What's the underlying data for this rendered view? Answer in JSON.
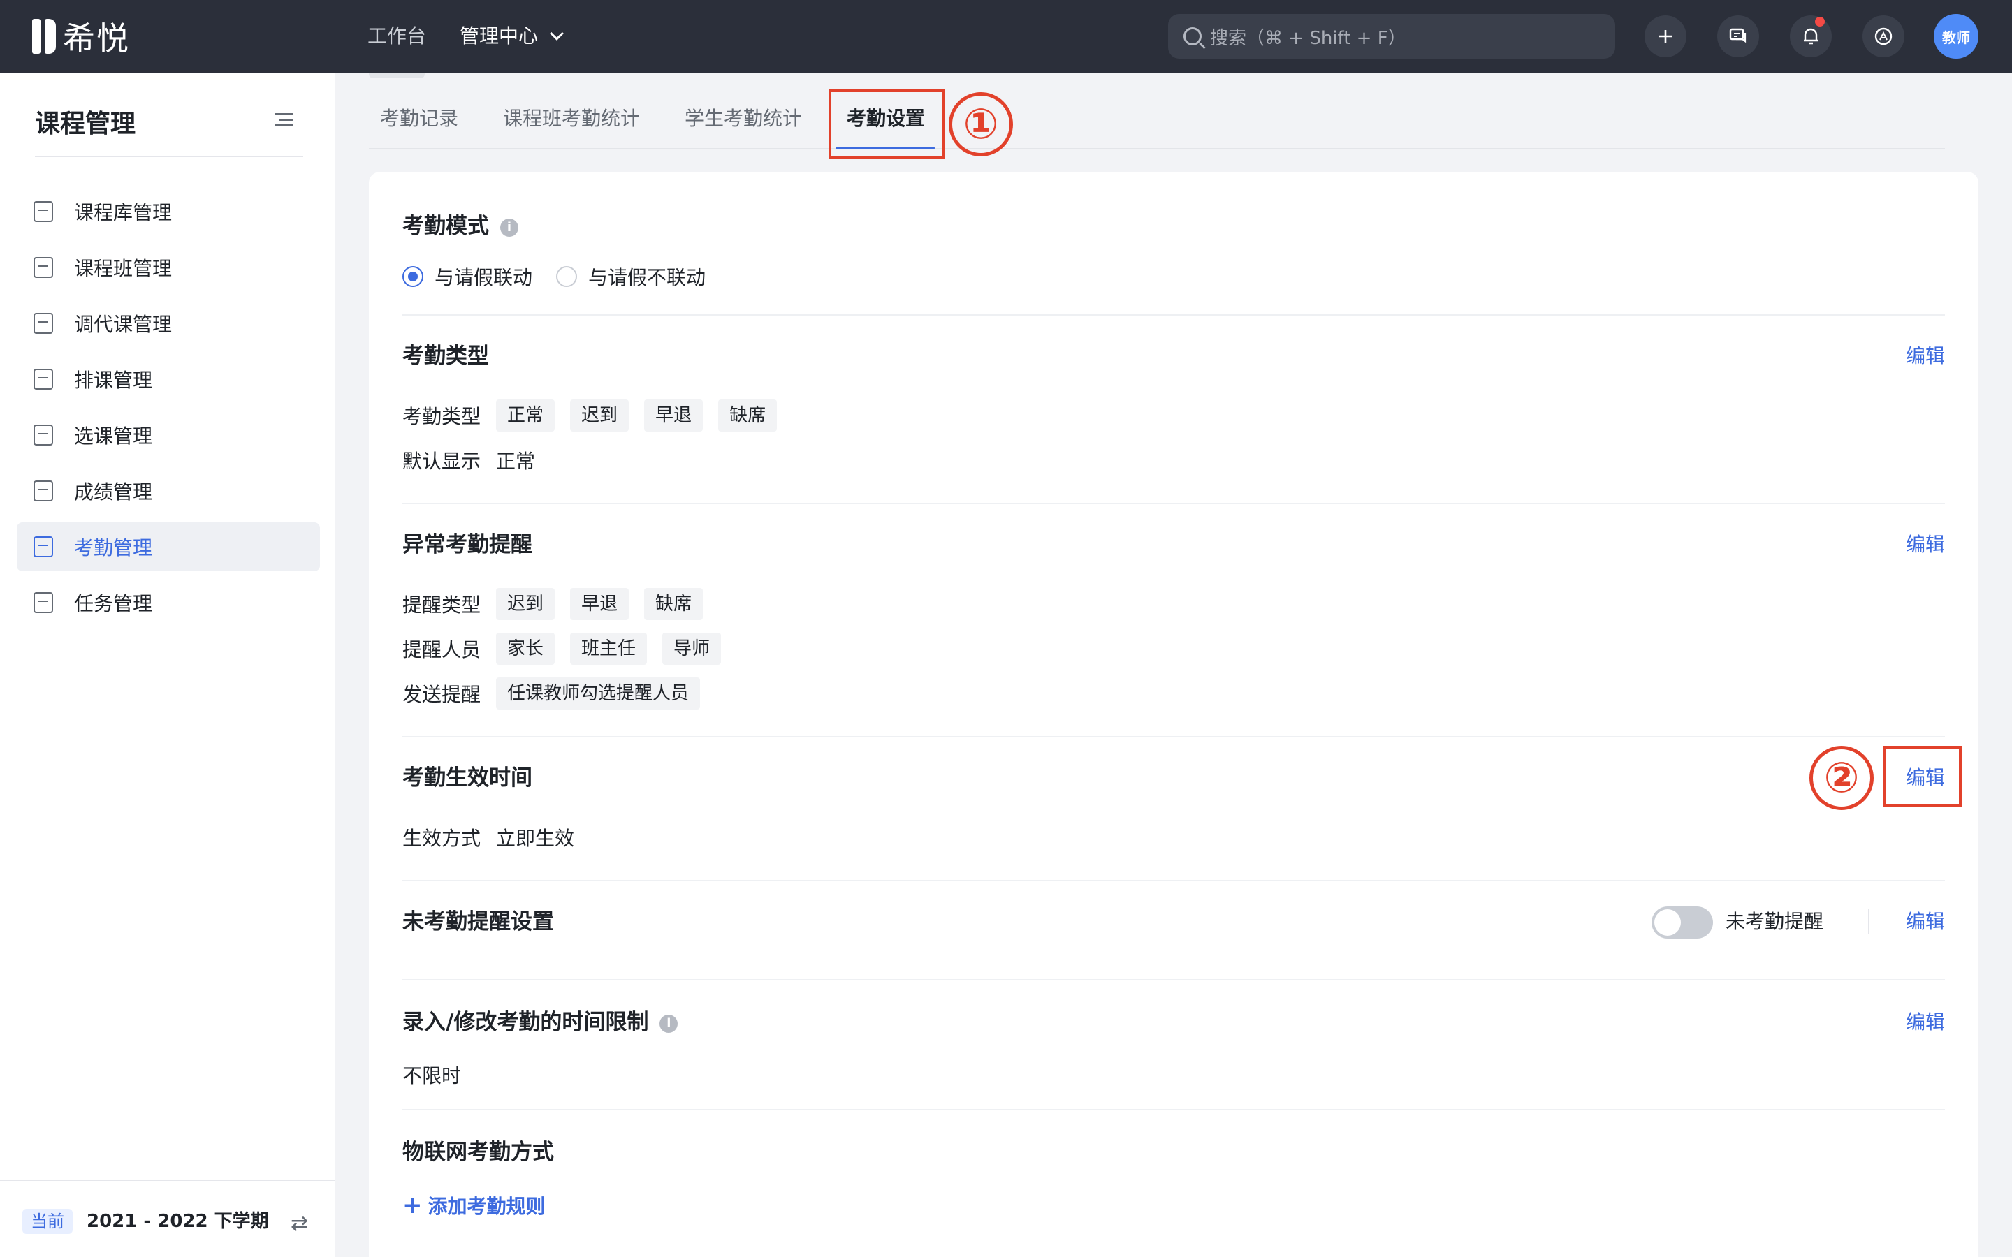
{
  "app": {
    "logo_text": "希悦"
  },
  "topnav": {
    "items": [
      {
        "label": "工作台"
      },
      {
        "label": "管理中心"
      }
    ],
    "search_placeholder": "搜索（⌘ + Shift + F）",
    "avatar_label": "教师"
  },
  "sidebar": {
    "title": "课程管理",
    "items": [
      {
        "label": "课程库管理",
        "icon": "library-icon"
      },
      {
        "label": "课程班管理",
        "icon": "class-icon"
      },
      {
        "label": "调代课管理",
        "icon": "substitute-icon"
      },
      {
        "label": "排课管理",
        "icon": "schedule-icon"
      },
      {
        "label": "选课管理",
        "icon": "checkbox-icon"
      },
      {
        "label": "成绩管理",
        "icon": "grade-icon"
      },
      {
        "label": "考勤管理",
        "icon": "calendar-icon"
      },
      {
        "label": "任务管理",
        "icon": "task-list-icon"
      }
    ],
    "active_item": "考勤管理",
    "footer": {
      "badge": "当前",
      "term": "2021 - 2022 下学期"
    }
  },
  "tabs": [
    {
      "label": "考勤记录"
    },
    {
      "label": "课程班考勤统计"
    },
    {
      "label": "学生考勤统计"
    },
    {
      "label": "考勤设置"
    }
  ],
  "annotations": {
    "one": "①",
    "two": "②"
  },
  "settings": {
    "mode": {
      "title": "考勤模式",
      "options": [
        {
          "label": "与请假联动",
          "checked": true
        },
        {
          "label": "与请假不联动",
          "checked": false
        }
      ]
    },
    "types": {
      "title": "考勤类型",
      "edit": "编辑",
      "row1_label": "考勤类型",
      "row1_tags": [
        "正常",
        "迟到",
        "早退",
        "缺席"
      ],
      "row2_label": "默认显示",
      "row2_value": "正常"
    },
    "abnormal": {
      "title": "异常考勤提醒",
      "edit": "编辑",
      "row1_label": "提醒类型",
      "row1_tags": [
        "迟到",
        "早退",
        "缺席"
      ],
      "row2_label": "提醒人员",
      "row2_tags": [
        "家长",
        "班主任",
        "导师"
      ],
      "row3_label": "发送提醒",
      "row3_tags": [
        "任课教师勾选提醒人员"
      ]
    },
    "effective": {
      "title": "考勤生效时间",
      "edit": "编辑",
      "row_label": "生效方式",
      "row_value": "立即生效"
    },
    "unrecorded": {
      "title": "未考勤提醒设置",
      "toggle_label": "未考勤提醒",
      "toggle_on": false,
      "edit": "编辑"
    },
    "time_limit": {
      "title": "录入/修改考勤的时间限制",
      "edit": "编辑",
      "value": "不限时"
    },
    "iot": {
      "title": "物联网考勤方式",
      "add": "添加考勤规则"
    }
  },
  "colors": {
    "accent": "#3d6bdf",
    "topbar": "#2b2f3a",
    "annotation": "#e2412b"
  }
}
